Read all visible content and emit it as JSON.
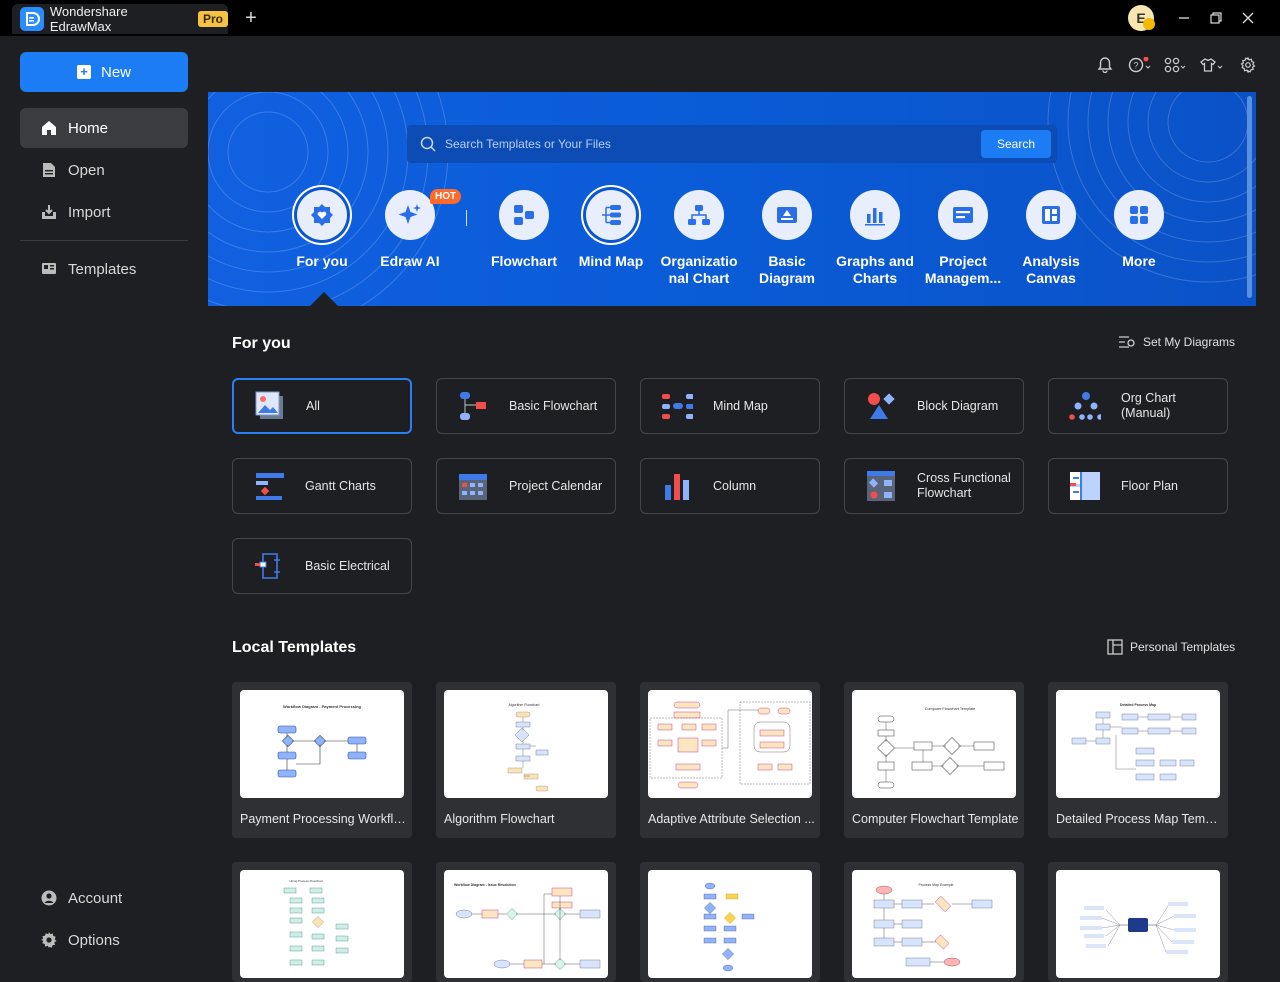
{
  "app": {
    "title": "Wondershare EdrawMax",
    "badge": "Pro",
    "avatar_initial": "E"
  },
  "sidebar": {
    "new_label": "New",
    "items": [
      {
        "label": "Home",
        "icon": "home-icon"
      },
      {
        "label": "Open",
        "icon": "file-icon"
      },
      {
        "label": "Import",
        "icon": "import-icon"
      },
      {
        "label": "Templates",
        "icon": "templates-icon"
      },
      {
        "label": "Account",
        "icon": "account-icon"
      },
      {
        "label": "Options",
        "icon": "gear-icon"
      }
    ]
  },
  "hero": {
    "search_placeholder": "Search Templates or Your Files",
    "search_button": "Search",
    "hot_badge": "HOT",
    "categories": [
      {
        "label": "For you"
      },
      {
        "label": "Edraw AI"
      },
      {
        "label": "Flowchart"
      },
      {
        "label": "Mind Map"
      },
      {
        "label": "Organizatio nal Chart"
      },
      {
        "label": "Basic Diagram"
      },
      {
        "label": "Graphs and Charts"
      },
      {
        "label": "Project Managem..."
      },
      {
        "label": "Analysis Canvas"
      },
      {
        "label": "More"
      }
    ]
  },
  "for_you": {
    "title": "For you",
    "link": "Set My Diagrams",
    "types": [
      {
        "label": "All"
      },
      {
        "label": "Basic Flowchart"
      },
      {
        "label": "Mind Map"
      },
      {
        "label": "Block Diagram"
      },
      {
        "label": "Org Chart (Manual)"
      },
      {
        "label": "Gantt Charts"
      },
      {
        "label": "Project Calendar"
      },
      {
        "label": "Column"
      },
      {
        "label": "Cross Functional Flowchart"
      },
      {
        "label": "Floor Plan"
      },
      {
        "label": "Basic Electrical"
      }
    ]
  },
  "local_templates": {
    "title": "Local Templates",
    "link": "Personal Templates",
    "items": [
      {
        "label": "Payment Processing Workflow",
        "thumb_title": "Workflow Diagram - Payment Processing"
      },
      {
        "label": "Algorithm Flowchart",
        "thumb_title": "Algorithm Flowchart"
      },
      {
        "label": "Adaptive Attribute Selection ..."
      },
      {
        "label": "Computer Flowchart Template",
        "thumb_title": "Computer Flowchart Template"
      },
      {
        "label": "Detailed Process Map Template",
        "thumb_title": "Detailed Process Map"
      },
      {
        "label": "",
        "thumb_title": "Hiring Process Flowchart"
      },
      {
        "label": "",
        "thumb_title": "Workflow Diagram - Issue Resolution"
      },
      {
        "label": ""
      },
      {
        "label": "",
        "thumb_title": "Process Map Example"
      },
      {
        "label": ""
      }
    ]
  }
}
